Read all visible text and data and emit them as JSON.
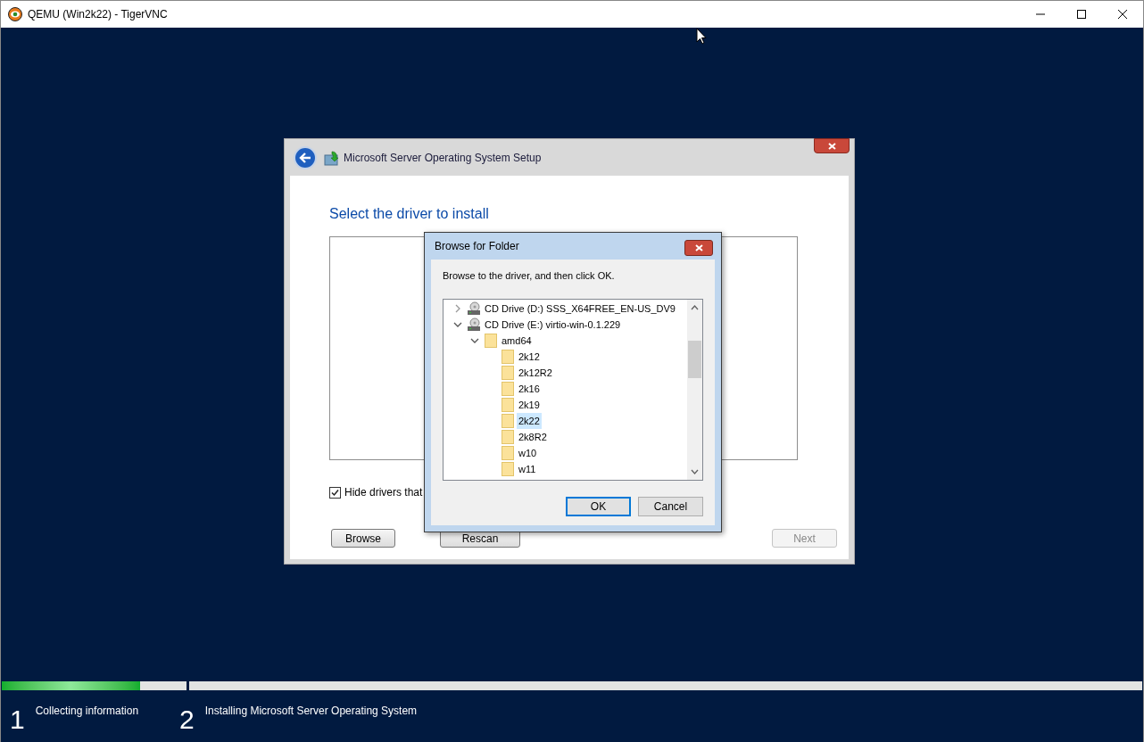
{
  "window": {
    "title": "QEMU (Win2k22) - TigerVNC"
  },
  "setup": {
    "title": "Microsoft Server Operating System Setup",
    "heading": "Select the driver to install",
    "hide_checkbox": {
      "label": "Hide drivers that",
      "checked": true
    },
    "buttons": [
      {
        "label": "Browse",
        "disabled": false
      },
      {
        "label": "Rescan",
        "disabled": false
      },
      {
        "label": "Next",
        "disabled": true
      }
    ]
  },
  "browse_dialog": {
    "title": "Browse for Folder",
    "instruction": "Browse to the driver, and then click OK.",
    "tree": [
      {
        "label": "CD Drive (D:) SSS_X64FREE_EN-US_DV9",
        "kind": "drive",
        "expanded": false,
        "selected": false
      },
      {
        "label": "CD Drive (E:) virtio-win-0.1.229",
        "kind": "drive",
        "expanded": true,
        "selected": false,
        "children": [
          {
            "label": "amd64",
            "kind": "folder",
            "expanded": true,
            "selected": false,
            "children": [
              {
                "label": "2k12",
                "kind": "folder",
                "selected": false
              },
              {
                "label": "2k12R2",
                "kind": "folder",
                "selected": false
              },
              {
                "label": "2k16",
                "kind": "folder",
                "selected": false
              },
              {
                "label": "2k19",
                "kind": "folder",
                "selected": false
              },
              {
                "label": "2k22",
                "kind": "folder",
                "selected": true
              },
              {
                "label": "2k8R2",
                "kind": "folder",
                "selected": false
              },
              {
                "label": "w10",
                "kind": "folder",
                "selected": false
              },
              {
                "label": "w11",
                "kind": "folder",
                "selected": false
              }
            ]
          }
        ]
      }
    ],
    "buttons": [
      {
        "label": "OK",
        "default": true
      },
      {
        "label": "Cancel",
        "default": false
      }
    ]
  },
  "progress": [
    {
      "number": "1",
      "label": "Collecting information",
      "level": 0.75
    },
    {
      "number": "2",
      "label": "Installing Microsoft Server Operating System",
      "level": 0
    }
  ]
}
